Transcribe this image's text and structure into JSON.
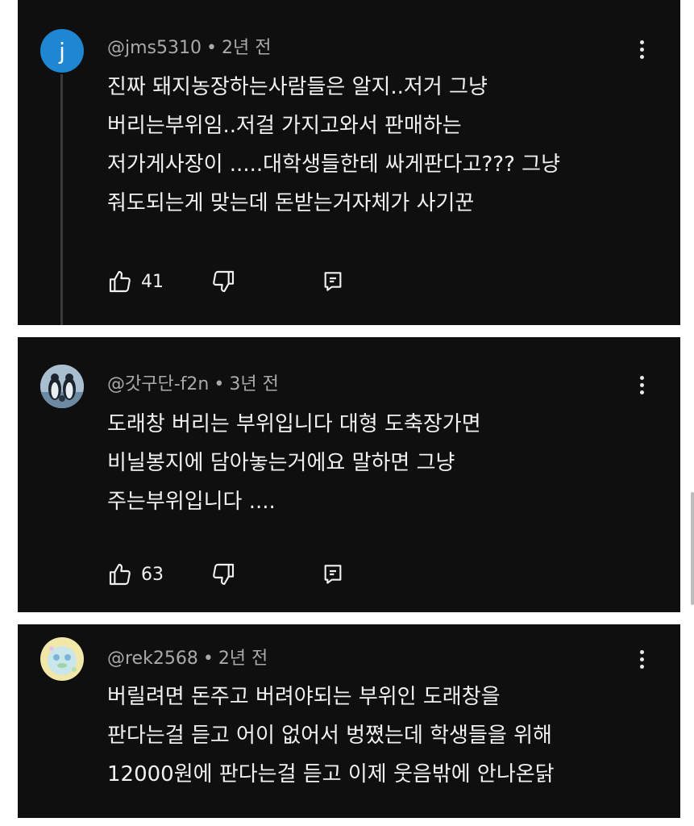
{
  "comments": [
    {
      "avatar_letter": "j",
      "avatar_color": "#1f86d1",
      "handle": "@jms5310",
      "time": "2년 전",
      "lines": [
        "진짜 돼지농장하는사람들은 알지..저거 그냥",
        "버리는부위임..저걸 가지고와서 판매하는",
        "저가게사장이 .....대학생들한테 싸게판다고???  그냥",
        "줘도되는게 맞는데 돈받는거자체가 사기꾼"
      ],
      "likes": "41"
    },
    {
      "avatar_icon": "penguin-avatar",
      "handle": "@갓구단-f2n",
      "time": "3년 전",
      "lines": [
        "도래창 버리는 부위입니다 대형 도축장가면",
        "비닐봉지에 담아놓는거에요 말하면 그냥",
        "주는부위입니다 ...."
      ],
      "likes": "63"
    },
    {
      "avatar_icon": "blob-avatar",
      "handle": "@rek2568",
      "time": "2년 전",
      "lines": [
        "버릴려면 돈주고 버려야되는 부위인 도래창을",
        "판다는걸 듣고 어이 없어서 벙쪘는데 학생들을 위해",
        "12000원에 판다는걸 듣고 이제 웃음밖에 안나온닭"
      ]
    }
  ],
  "separator": "•",
  "icons": {
    "like": "thumbs-up-icon",
    "dislike": "thumbs-down-icon",
    "reply": "reply-icon",
    "more": "more-vert-icon"
  }
}
